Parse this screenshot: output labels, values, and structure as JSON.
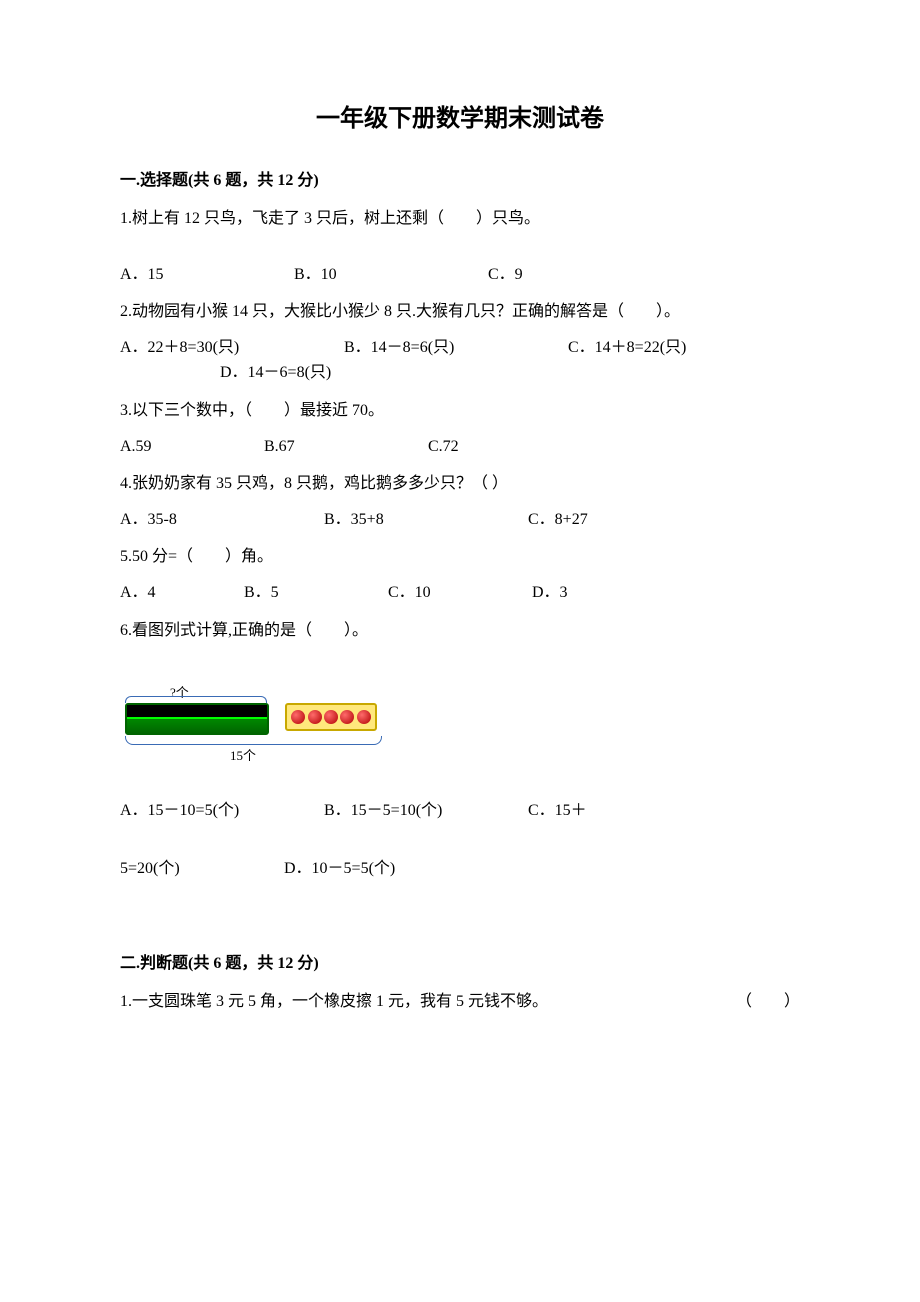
{
  "title": "一年级下册数学期末测试卷",
  "section1": {
    "header": "一.选择题(共 6 题，共 12 分)",
    "q1": {
      "text": "1.树上有 12 只鸟，飞走了 3 只后，树上还剩（　　）只鸟。",
      "optA": "A．15",
      "optB": "B．10",
      "optC": "C．9"
    },
    "q2": {
      "text": "2.动物园有小猴 14 只，大猴比小猴少 8 只.大猴有几只？正确的解答是（　　）。",
      "optA": "A．22＋8=30(只)",
      "optB": "B．14－8=6(只)",
      "optC": "C．14＋8=22(只)",
      "optD": "D．14－6=8(只)"
    },
    "q3": {
      "text": "3.以下三个数中，（　　）最接近 70。",
      "optA": "A.59",
      "optB": "B.67",
      "optC": "C.72"
    },
    "q4": {
      "text": "4.张奶奶家有 35 只鸡，8 只鹅，鸡比鹅多多少只？（  ）",
      "optA": "A．35-8",
      "optB": "B．35+8",
      "optC": "C．8+27"
    },
    "q5": {
      "text": "5.50 分=（　　）角。",
      "optA": "A．4",
      "optB": "B．5",
      "optC": "C．10",
      "optD": "D．3"
    },
    "q6": {
      "text": "6.看图列式计算,正确的是（　　）。",
      "qmark": "?个",
      "total": "15个",
      "optA": "A．15－10=5(个)",
      "optB": "B．15－5=10(个)",
      "optC": "C．15＋",
      "line2a": "5=20(个)",
      "line2b": "D．10－5=5(个)"
    }
  },
  "section2": {
    "header": "二.判断题(共 6 题，共 12 分)",
    "q1": {
      "text": "1.一支圆珠笔 3 元 5 角，一个橡皮擦 1 元，我有 5 元钱不够。",
      "blank": "（　　）"
    }
  }
}
